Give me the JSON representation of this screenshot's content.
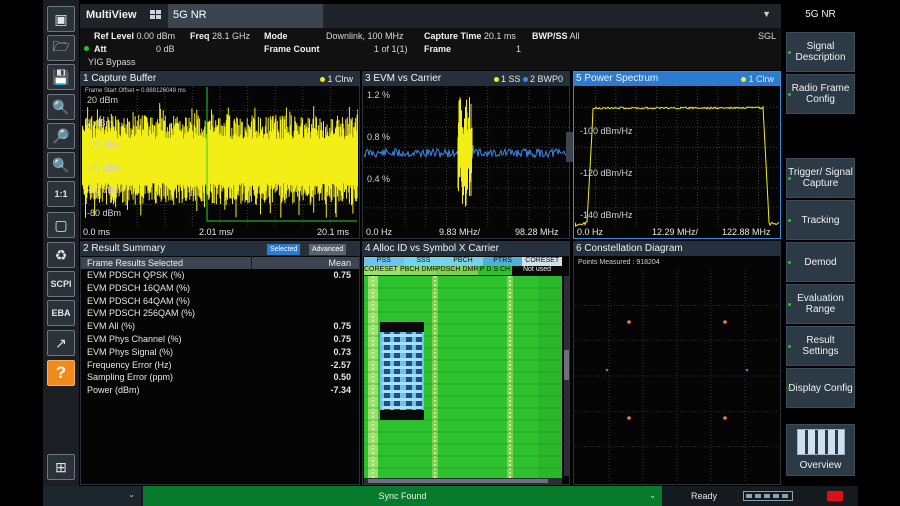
{
  "app": {
    "title": "MultiView",
    "active_tab": "5G NR",
    "softkey_header": "5G NR"
  },
  "infobar": {
    "ref_level_label": "Ref Level",
    "ref_level_value": "0.00 dBm",
    "freq_label": "Freq",
    "freq_value": "28.1 GHz",
    "mode_label": "Mode",
    "mode_value": "Downlink, 100 MHz",
    "capture_time_label": "Capture Time",
    "capture_time_value": "20.1 ms",
    "bwp_ss_label": "BWP/SS",
    "bwp_ss_value": "All",
    "sgl": "SGL",
    "att_label": "Att",
    "att_value": "0 dB",
    "frame_count_label": "Frame Count",
    "frame_count_value": "1 of 1(1)",
    "frame_label": "Frame",
    "frame_value": "1",
    "yig_bypass": "YIG Bypass"
  },
  "toolbar": {
    "scpi": "SCPI",
    "eba": "EBA",
    "zoom_1_1": "1:1",
    "help": "?"
  },
  "windows": {
    "capture_buffer": {
      "title": "1 Capture Buffer",
      "trace": "1 Clrw",
      "frame_start_offset": "Frame Start Offset = 0.888126048 ms",
      "y_labels": [
        "20 dBm",
        "0 dBm",
        "-20 dBm",
        "-40 dBm",
        "-60 dBm",
        "-80 dBm"
      ],
      "x_start": "0.0 ms",
      "x_mid": "2.01 ms/",
      "x_end": "20.1 ms"
    },
    "evm_vs_carrier": {
      "title": "3 EVM vs Carrier",
      "trace1": "1 SS",
      "trace2": "2 BWP0",
      "y_labels": [
        "1.2 %",
        "0.8 %",
        "0.4 %"
      ],
      "x_start": "0.0 Hz",
      "x_mid": "9.83 MHz/",
      "x_end": "98.28 MHz"
    },
    "power_spectrum": {
      "title": "5 Power Spectrum",
      "trace": "1 Clrw",
      "y_labels": [
        "-100 dBm/Hz",
        "-120 dBm/Hz",
        "-140 dBm/Hz"
      ],
      "x_start": "0.0 Hz",
      "x_mid": "12.29 MHz/",
      "x_end": "122.88 MHz"
    },
    "result_summary": {
      "title": "2 Result Summary",
      "btn_selected": "Selected",
      "btn_advanced": "Advanced",
      "col_name": "Frame Results Selected",
      "col_mean": "Mean",
      "rows": [
        {
          "name": "EVM PDSCH QPSK (%)",
          "mean": "0.75"
        },
        {
          "name": "EVM PDSCH 16QAM (%)",
          "mean": ""
        },
        {
          "name": "EVM PDSCH 64QAM (%)",
          "mean": ""
        },
        {
          "name": "EVM PDSCH 256QAM (%)",
          "mean": ""
        },
        {
          "name": "EVM All (%)",
          "mean": "0.75"
        },
        {
          "name": "EVM Phys Channel (%)",
          "mean": "0.75"
        },
        {
          "name": "EVM Phys Signal (%)",
          "mean": "0.73"
        },
        {
          "name": "Frequency Error (Hz)",
          "mean": "-2.57"
        },
        {
          "name": "Sampling Error (ppm)",
          "mean": "0.50"
        },
        {
          "name": "Power (dBm)",
          "mean": "-7.34"
        }
      ]
    },
    "alloc": {
      "title": "4 Alloc ID vs Symbol X Carrier",
      "legend_top": [
        {
          "label": "PSS",
          "color": "#6fc1ee"
        },
        {
          "label": "SSS",
          "color": "#6fd8f0"
        },
        {
          "label": "PBCH",
          "color": "#7ad2e8"
        },
        {
          "label": "PTRS",
          "color": "#4fb1d8"
        },
        {
          "label": "CORESET",
          "color": "#d2e0e8"
        }
      ],
      "legend_bottom": [
        {
          "label": "CORESET DMRS",
          "color": "#9be26a"
        },
        {
          "label": "PBCH DMRS",
          "color": "#8fd85c"
        },
        {
          "label": "PDSCH DMRS",
          "color": "#7fd04c"
        },
        {
          "label": "P D S CH",
          "color": "#2ec22e"
        },
        {
          "label": "Not used",
          "color": "#0a0a0a"
        }
      ]
    },
    "constellation": {
      "title": "6 Constellation Diagram",
      "points_measured": "Points Measured : 918204"
    }
  },
  "softkeys": [
    {
      "label": "Signal Description",
      "marker": true
    },
    {
      "label": "Radio Frame Config",
      "marker": true
    },
    {
      "label": "",
      "marker": false
    },
    {
      "label": "Trigger/ Signal Capture",
      "marker": true
    },
    {
      "label": "Tracking",
      "marker": true
    },
    {
      "label": "Demod",
      "marker": true
    },
    {
      "label": "Evaluation Range",
      "marker": true
    },
    {
      "label": "Result Settings",
      "marker": true
    },
    {
      "label": "Display Config",
      "marker": true
    },
    {
      "label": "Overview",
      "marker": false
    }
  ],
  "status": {
    "sync": "Sync Found",
    "ready": "Ready"
  },
  "colors": {
    "trace_yellow": "#f2ee16",
    "trace_blue": "#3b86e6",
    "alloc_green": "#2ec22e",
    "status_green": "#087a2c",
    "accent_blue": "#2b7bd1"
  }
}
